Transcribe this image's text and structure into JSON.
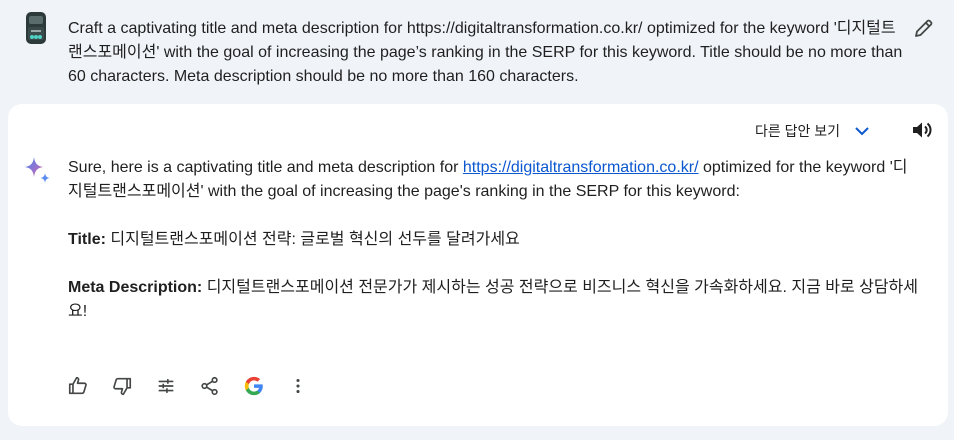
{
  "prompt": {
    "text": "Craft a captivating title and meta description for https://digitaltransformation.co.kr/  optimized for the keyword '디지털트랜스포메이션' with the goal of increasing the page’s ranking in the SERP for this keyword. Title should be no more than 60 characters. Meta description should be no more than 160 characters."
  },
  "response": {
    "drafts_label": "다른 답안 보기",
    "intro_before": "Sure, here is a captivating title and meta description for ",
    "intro_link": "https://digitaltransformation.co.kr/",
    "intro_after": " optimized for the keyword '디지털트랜스포메이션' with the goal of increasing the page's ranking in the SERP for this keyword:",
    "title_label": "Title:",
    "title_value": " 디지털트랜스포메이션 전략: 글로벌 혁신의 선두를 달려가세요",
    "meta_label": "Meta Description:",
    "meta_value": " 디지털트랜스포메이션 전문가가 제시하는 성공 전략으로 비즈니스 혁신을 가속화하세요. 지금 바로 상담하세요!"
  },
  "icons": {
    "edit": "pencil-icon",
    "speaker": "speaker-icon",
    "spark": "gemini-spark-icon",
    "drafts_chevron": "chevron-down-icon",
    "actions": [
      "thumbs-up-icon",
      "thumbs-down-icon",
      "tune-icon",
      "share-icon",
      "google-icon",
      "more-vert-icon"
    ]
  },
  "colors": {
    "page_bg": "#f0f4f9",
    "card_bg": "#ffffff",
    "link": "#0b57d0",
    "chevron": "#0b57d0",
    "text": "#1f1f1f"
  }
}
